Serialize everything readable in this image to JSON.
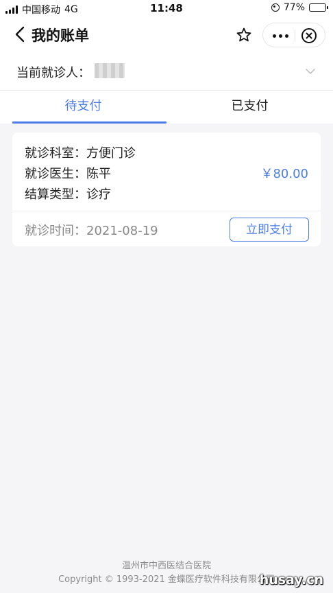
{
  "status_bar": {
    "carrier": "中国移动",
    "network": "4G",
    "time": "11:48",
    "battery": "77%",
    "battery_level": 0.77
  },
  "nav": {
    "title": "我的账单"
  },
  "patient": {
    "label": "当前就诊人："
  },
  "tabs": [
    {
      "label": "待支付",
      "active": true
    },
    {
      "label": "已支付",
      "active": false
    }
  ],
  "bill": {
    "department": "就诊科室：方便门诊",
    "doctor": "就诊医生：陈平",
    "settlement_type": "结算类型：诊疗",
    "amount": "￥80.00",
    "visit_time": "就诊时间：2021-08-19",
    "pay_label": "立即支付"
  },
  "footer": {
    "hospital": "温州市中西医结合医院",
    "copyright": "Copyright © 1993-2021 金蝶医疗软件科技有限公司"
  },
  "watermark": "husay.cn",
  "colors": {
    "accent": "#4a7de8",
    "background": "#f5f5f7"
  }
}
